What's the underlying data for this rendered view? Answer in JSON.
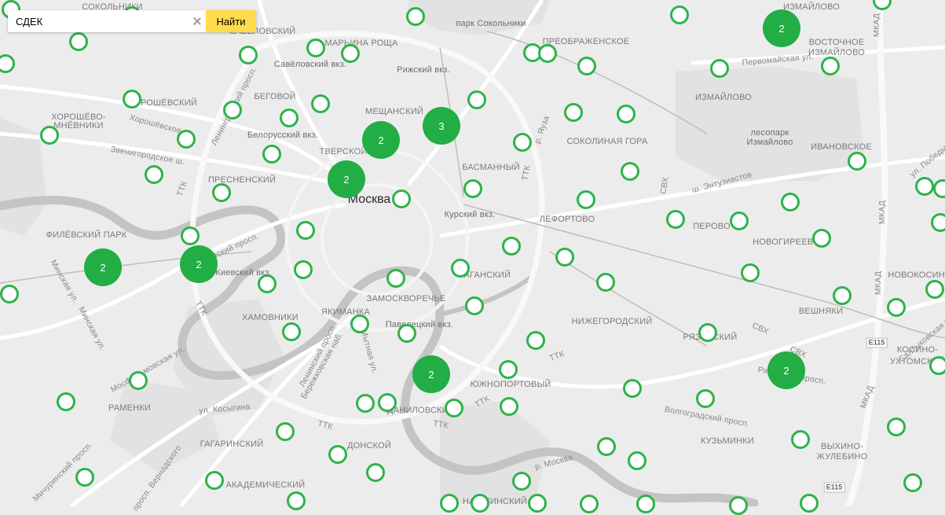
{
  "search": {
    "value": "СДЕК",
    "button_label": "Найти"
  },
  "colors": {
    "marker": "#2db34a",
    "cluster": "#22ad45",
    "button": "#ffdb4d",
    "map_background": "#ececec",
    "river": "#c4c4c4"
  },
  "map": {
    "city_label": "Москва",
    "district_labels": [
      "СОКОЛЬНИКИ",
      "САВЁЛОВСКИЙ",
      "МАРЬИНА РОЩА",
      "ПРЕОБРАЖЕНСКОЕ",
      "ИЗМАЙЛОВО",
      "ВОСТОЧНОЕ",
      "ИЗМАЙЛОВО",
      "БЕГОВОЙ",
      "ХОРОШЁВСКИЙ",
      "ХОРОШЁВО-",
      "МНЁВНИКИ",
      "МЕЩАНСКИЙ",
      "ИЗМАЙЛОВО",
      "ТВЕРСКОЙ",
      "СОКОЛИНАЯ ГОРА",
      "ИВАНОВСКОЕ",
      "БАСМАННЫЙ",
      "ПРЕСНЕНСКИЙ",
      "ЛЕФОРТОВО",
      "ПЕРОВО",
      "НОВОГИРЕЕВО",
      "ФИЛЁВСКИЙ ПАРК",
      "НОВОКОСИНО",
      "ТАГАНСКИЙ",
      "ЗАМОСКВОРЕЧЬЕ",
      "ВЕШНЯКИ",
      "ХАМОВНИКИ",
      "ЯКИМАНКА",
      "НИЖЕГОРОДСКИЙ",
      "РЯЗАНСКИЙ",
      "КОСИНО-",
      "УХТОМСКИЙ",
      "ЮЖНОПОРТОВЫЙ",
      "РАМЕНКИ",
      "ДАНИЛОВСКИЙ",
      "КУЗЬМИНКИ",
      "ГАГАРИНСКИЙ",
      "ДОНСКОЙ",
      "ВЫХИНО-",
      "ЖУЛЕБИНО",
      "АКАДЕМИЧЕСКИЙ",
      "НАГАТИНСКИЙ"
    ],
    "road_labels": [
      "Хорошёвское ш.",
      "Звенигородское ш.",
      "Кутузовский просп.",
      "Ленинградский просп.",
      "Минская ул.",
      "Мосфильмовская ул.",
      "Мичуринский просп.",
      "Ленинский просп.",
      "Мытная ул.",
      "ул. Косыгина",
      "просп. Вернадского",
      "Волгоградский просп.",
      "Рязанский просп.",
      "Первомайская ул.",
      "ш. Энтузиастов",
      "р. Яуза",
      "р. Москва",
      "Бережковская наб.",
      "ул. Победы",
      "Салтыковская ул.",
      "Минская ул."
    ],
    "ring_labels": [
      "ТТК",
      "ТТК",
      "ТТК",
      "ТТК",
      "ТТК",
      "ТТК",
      "ТТК",
      "СВХ",
      "СВХ",
      "СВХ",
      "МКАД",
      "МКАД",
      "МКАД",
      "МКАД"
    ],
    "highway_shields": [
      "E115",
      "E115"
    ],
    "feature_labels": [
      "парк Сокольники",
      "Савёловский вкз.",
      "Рижский вкз.",
      "Белорусский вкз.",
      "Киевский вкз.",
      "Курский вкз.",
      "Павелецкий вкз.",
      "лесопарк",
      "Измайлово"
    ],
    "clusters": [
      "2",
      "3",
      "2",
      "2",
      "2",
      "2",
      "2",
      "2",
      "2"
    ],
    "marker_count": 88
  }
}
